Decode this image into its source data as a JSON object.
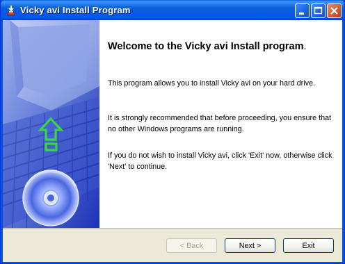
{
  "window": {
    "title": "Vicky avi Install Program",
    "icons": {
      "app": "installer-icon",
      "minimize": "minimize-icon",
      "maximize": "maximize-icon",
      "close": "close-icon"
    }
  },
  "sidebar": {
    "graphics": [
      "computer-monitor-graphic",
      "keyboard-graphic",
      "up-arrow-icon",
      "cd-disc-icon"
    ]
  },
  "content": {
    "heading": "Welcome to the Vicky avi Install program",
    "heading_period": ".",
    "paragraphs": [
      "This program allows you to install Vicky avi on your hard drive.",
      "It is strongly recommended that before proceeding, you ensure that no other Windows programs are running.",
      "If you do not wish to install Vicky avi, click 'Exit' now, otherwise click 'Next' to continue."
    ]
  },
  "buttons": {
    "back": "< Back",
    "next": "Next >",
    "exit": "Exit"
  },
  "colors": {
    "titlebar": "#0a5ed8",
    "sidebar": "#2a46c8",
    "arrow": "#39d54a",
    "content_bg": "#ffffff"
  }
}
